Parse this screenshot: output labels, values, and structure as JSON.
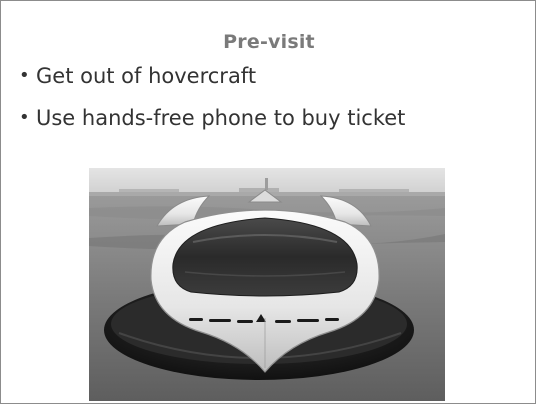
{
  "slide": {
    "title": "Pre-visit",
    "bullets": [
      {
        "marker": "•",
        "text": "Get out of hovercraft"
      },
      {
        "marker": "•",
        "text": "Use hands-free phone to buy ticket"
      }
    ],
    "image": {
      "icon": "hovercraft-photo",
      "tone": "grayscale"
    }
  }
}
